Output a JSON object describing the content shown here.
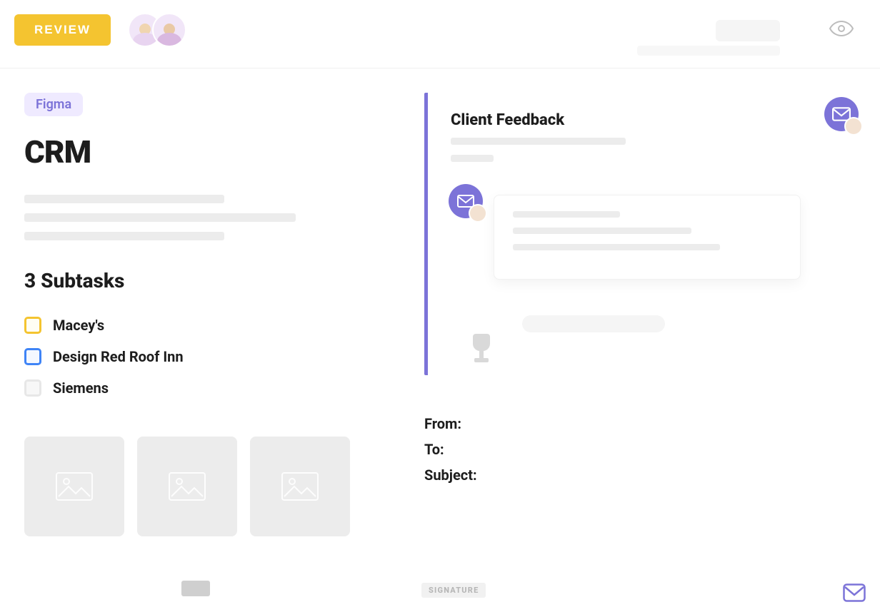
{
  "colors": {
    "accent_purple": "#7c73d8",
    "accent_yellow": "#f4c430",
    "accent_blue": "#3f84f6"
  },
  "topbar": {
    "review_label": "REVIEW",
    "eye_icon": "eye-icon"
  },
  "left": {
    "tag": "Figma",
    "title": "CRM",
    "subtasks_heading": "3 Subtasks",
    "subtasks": [
      {
        "label": "Macey's",
        "color": "yellow"
      },
      {
        "label": "Design Red Roof Inn",
        "color": "blue"
      },
      {
        "label": "Siemens",
        "color": "grey"
      }
    ],
    "thumbnails": 3
  },
  "right": {
    "feedback_title": "Client Feedback"
  },
  "compose": {
    "from_label": "From:",
    "to_label": "To:",
    "subject_label": "Subject:"
  },
  "footer": {
    "signature_label": "SIGNATURE"
  }
}
